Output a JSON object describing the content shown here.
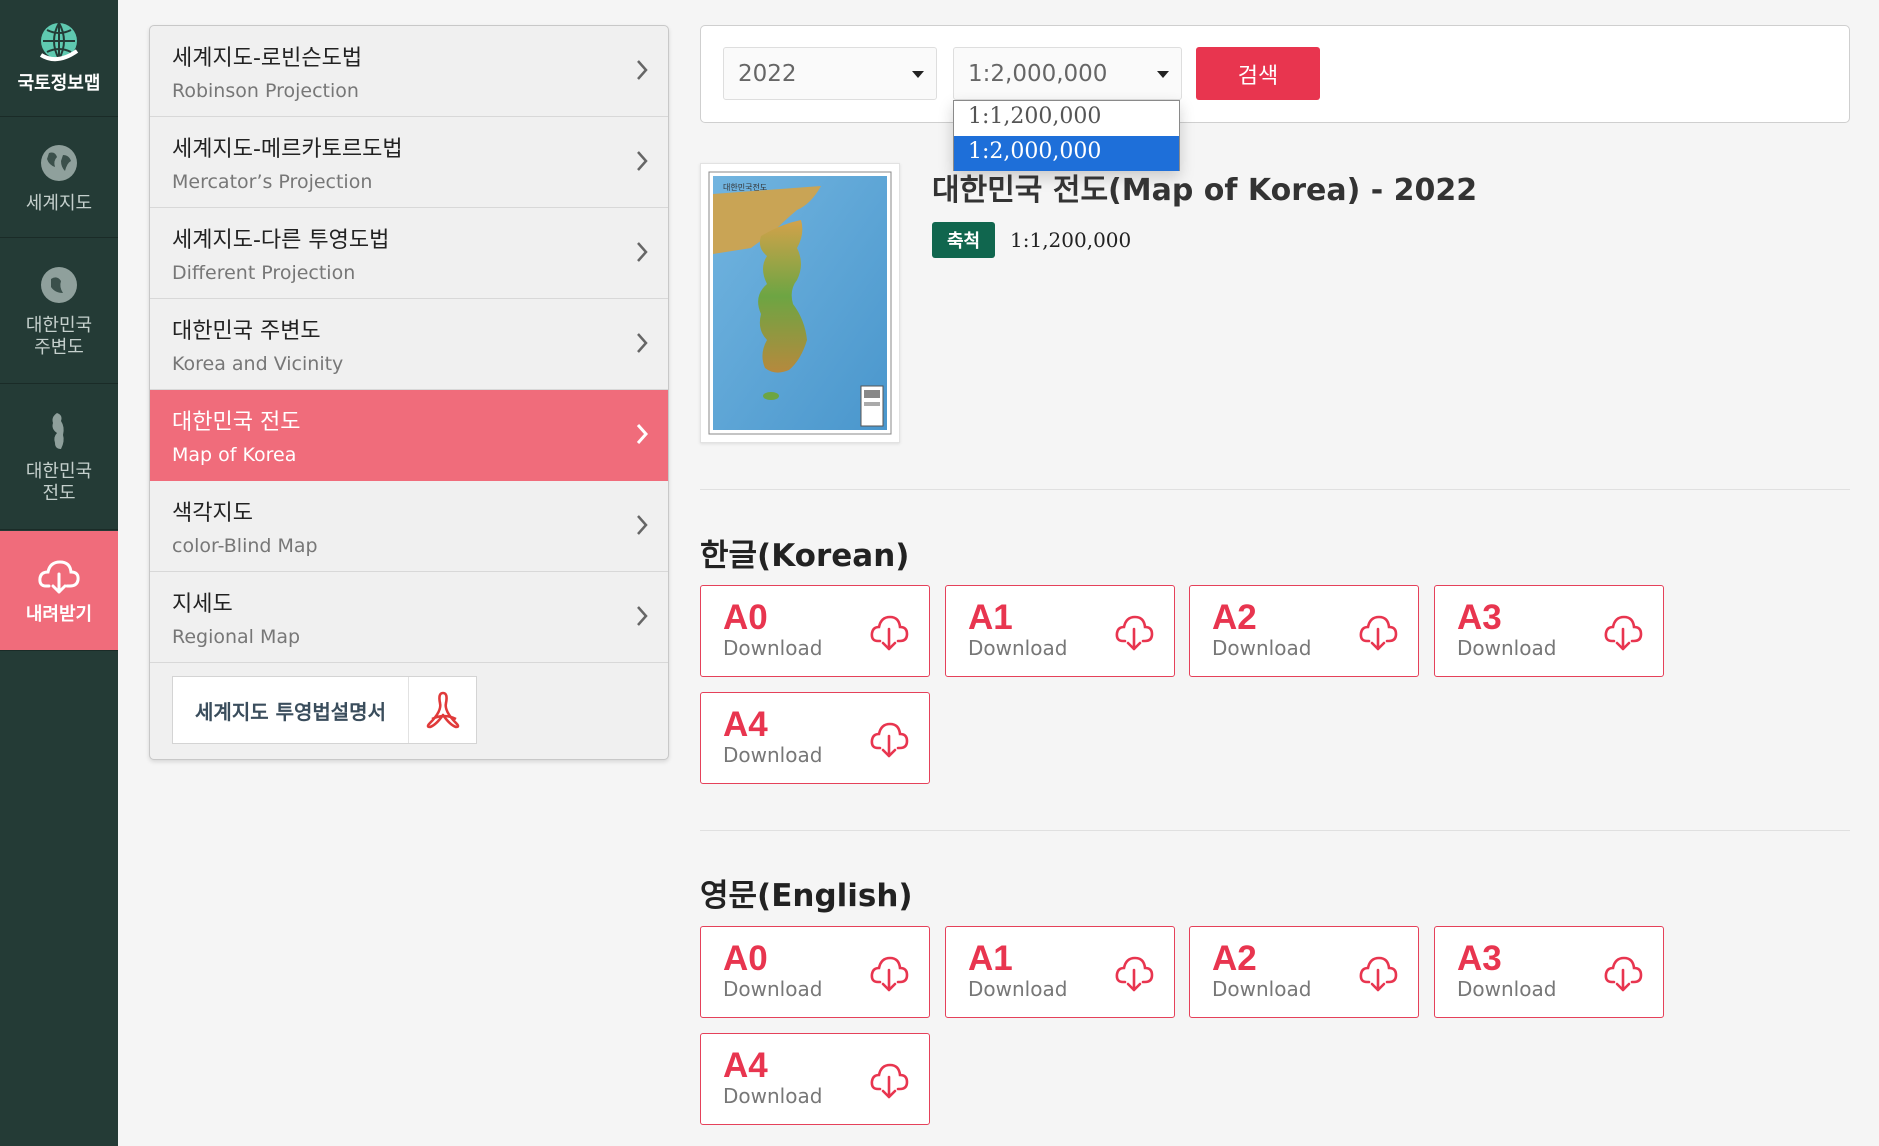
{
  "rail": {
    "logo_label": "국토정보맵",
    "items": [
      {
        "label": "세계지도",
        "icon": "globe-icon"
      },
      {
        "label": "대한민국\n주변도",
        "icon": "vicinity-globe-icon"
      },
      {
        "label": "대한민국\n전도",
        "icon": "korea-map-icon"
      },
      {
        "label": "내려받기",
        "icon": "cloud-download-icon"
      }
    ]
  },
  "menu": {
    "items": [
      {
        "ko": "세계지도-로빈슨도법",
        "en": "Robinson Projection"
      },
      {
        "ko": "세계지도-메르카토르도법",
        "en": "Mercator’s Projection"
      },
      {
        "ko": "세계지도-다른 투영도법",
        "en": "Different Projection"
      },
      {
        "ko": "대한민국 주변도",
        "en": "Korea and Vicinity"
      },
      {
        "ko": "대한민국 전도",
        "en": "Map of Korea"
      },
      {
        "ko": "색각지도",
        "en": "color-Blind Map"
      },
      {
        "ko": "지세도",
        "en": "Regional Map"
      }
    ],
    "active_index": 4,
    "pdf_button_label": "세계지도 투영법설명서"
  },
  "search": {
    "year_value": "2022",
    "scale_value": "1:2,000,000",
    "button_label": "검색",
    "scale_options": [
      "1:1,200,000",
      "1:2,000,000"
    ],
    "selected_option": 1
  },
  "map": {
    "thumb_caption": "대한민국전도",
    "title": "대한민국 전도(Map of Korea) - 2022",
    "scale_badge": "축척",
    "scale_value": "1:1,200,000"
  },
  "sections": [
    {
      "title": "한글(Korean)",
      "cards": [
        {
          "size": "A0",
          "label": "Download"
        },
        {
          "size": "A1",
          "label": "Download"
        },
        {
          "size": "A2",
          "label": "Download"
        },
        {
          "size": "A3",
          "label": "Download"
        },
        {
          "size": "A4",
          "label": "Download"
        }
      ]
    },
    {
      "title": "영문(English)",
      "cards": [
        {
          "size": "A0",
          "label": "Download"
        },
        {
          "size": "A1",
          "label": "Download"
        },
        {
          "size": "A2",
          "label": "Download"
        },
        {
          "size": "A3",
          "label": "Download"
        },
        {
          "size": "A4",
          "label": "Download"
        }
      ]
    }
  ],
  "colors": {
    "rail_bg": "#243b36",
    "accent_pink": "#f06c7b",
    "accent_red": "#e8354f",
    "badge_green": "#10664e",
    "selection_blue": "#1e6fd9"
  }
}
